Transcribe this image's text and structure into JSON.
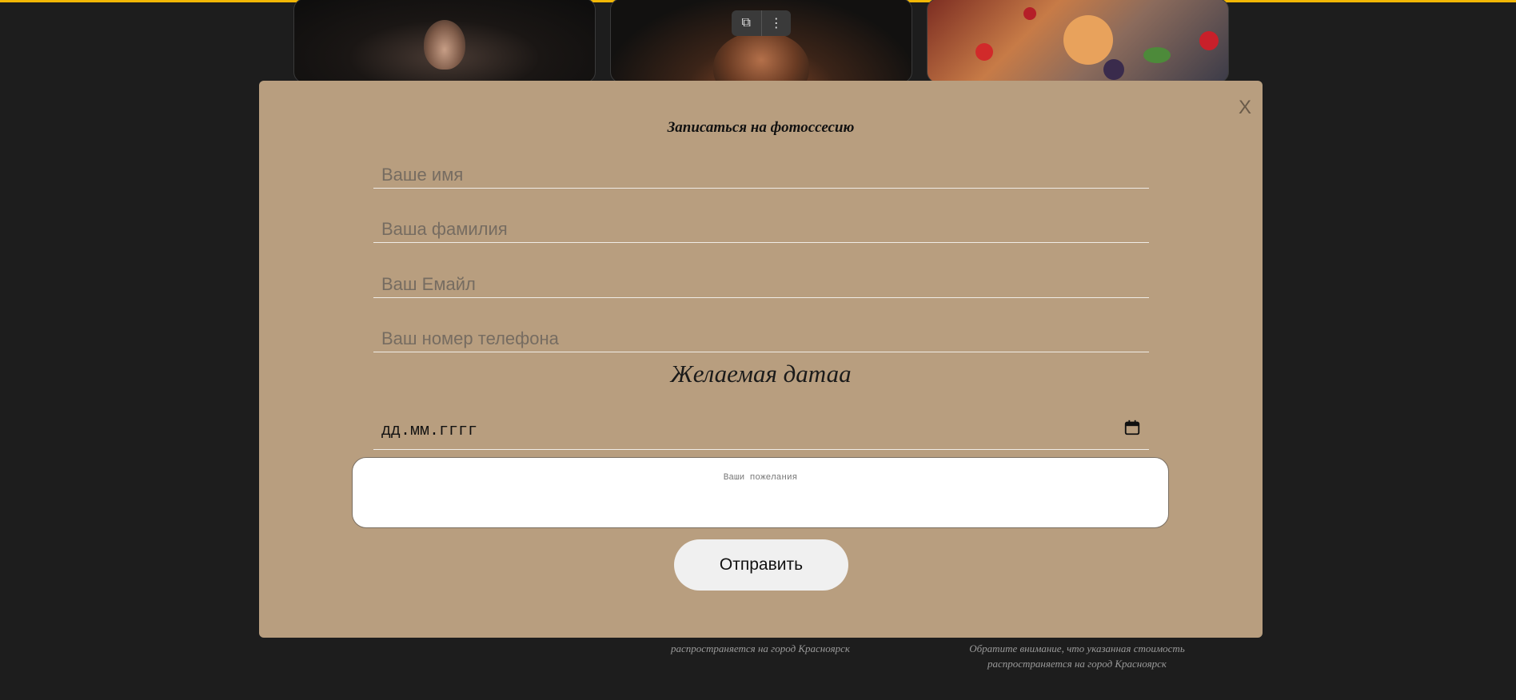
{
  "gallery": {
    "toolbar": {
      "open_icon": "open-external-icon",
      "open_glyph": "⧉",
      "menu_icon": "more-vertical-icon",
      "menu_glyph": "⋮"
    },
    "notes": [
      "распространяется на город Красноярск",
      "Обратите внимание, что указанная стоимость",
      "распространяется на город Красноярск"
    ]
  },
  "modal": {
    "close_label": "X",
    "title": "Записаться на фотоссесию",
    "fields": {
      "first_name_placeholder": "Ваше имя",
      "last_name_placeholder": "Ваша фамилия",
      "email_placeholder": "Ваш Емайл",
      "phone_placeholder": "Ваш номер телефона"
    },
    "date_heading": "Желаемая датаа",
    "date_placeholder": "дд.мм.гггг",
    "wishes_placeholder": "Ваши пожелания",
    "submit_label": "Отправить"
  },
  "colors": {
    "accent_line": "#f2b705",
    "modal_bg": "#b89e7f",
    "page_bg": "#1d1d1d"
  }
}
